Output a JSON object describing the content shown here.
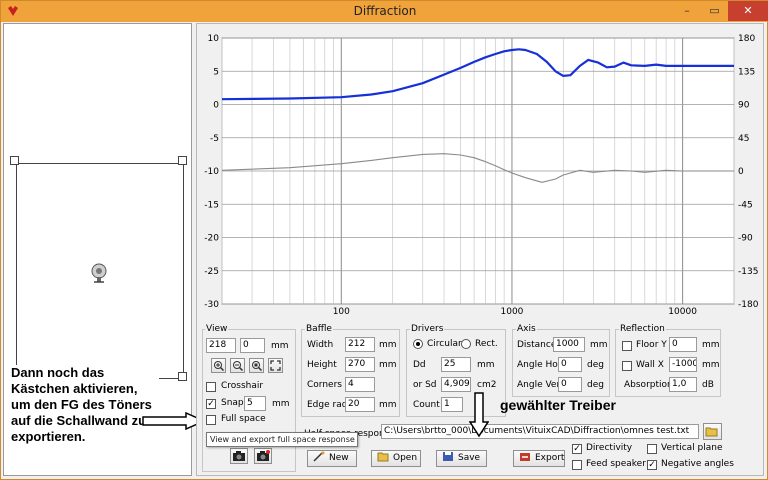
{
  "window": {
    "title": "Diffraction"
  },
  "titlebar": {
    "min_glyph": "–",
    "max_glyph": "▭",
    "close_glyph": "✕"
  },
  "annotations": {
    "left_note": "Dann noch das Kästchen aktivieren, um den FG des Töners auf die Schallwand zu exportieren.",
    "driver_note": "gewählter Treiber"
  },
  "view": {
    "group_label": "View",
    "coord_x": "218",
    "coord_y": "0",
    "coord_unit": "mm",
    "crosshair_label": "Crosshair",
    "crosshair_checked": false,
    "snap_label": "Snap",
    "snap_checked": true,
    "snap_value": "5",
    "snap_unit": "mm",
    "full_space_label": "Full space",
    "full_space_checked": false,
    "zoom_icons": [
      "zoom-in-icon",
      "zoom-out-icon",
      "zoom-window-icon",
      "zoom-extents-icon"
    ]
  },
  "tooltip": "View and export full space response",
  "baffle": {
    "group_label": "Baffle",
    "width_label": "Width",
    "width_value": "212",
    "width_unit": "mm",
    "height_label": "Height",
    "height_value": "270",
    "height_unit": "mm",
    "corners_label": "Corners",
    "corners_value": "4",
    "edge_label": "Edge rad.",
    "edge_value": "20",
    "edge_unit": "mm"
  },
  "drivers": {
    "group_label": "Drivers",
    "circular_label": "Circular",
    "circular_selected": true,
    "rect_label": "Rect.",
    "rect_selected": false,
    "dd_label": "Dd",
    "dd_value": "25",
    "dd_unit": "mm",
    "sd_label": "or Sd",
    "sd_value": "4,909",
    "sd_unit": "cm2",
    "count_label": "Count",
    "count_value": "1"
  },
  "axis": {
    "group_label": "Axis",
    "distance_label": "Distance",
    "distance_value": "1000",
    "distance_unit": "mm",
    "hor_label": "Angle Hor",
    "hor_value": "0",
    "hor_unit": "deg",
    "ver_label": "Angle Ver",
    "ver_value": "0",
    "ver_unit": "deg"
  },
  "reflection": {
    "group_label": "Reflection",
    "floor_label": "Floor Y",
    "floor_checked": false,
    "floor_value": "0",
    "floor_unit": "mm",
    "wall_label": "Wall  X",
    "wall_checked": false,
    "wall_value": "-1000",
    "wall_unit": "mm",
    "absorption_label": "Absorption",
    "absorption_value": "1,0",
    "absorption_unit": "dB"
  },
  "half_space": {
    "label": "Half space response",
    "path": "C:\\Users\\brtto_000\\Documents\\VituixCAD\\Diffraction\\omnes test.txt"
  },
  "buttons": {
    "new": "New",
    "open": "Open",
    "save": "Save",
    "export": "Export"
  },
  "options": {
    "directivity_label": "Directivity",
    "directivity_checked": true,
    "vertical_plane_label": "Vertical plane",
    "vertical_plane_checked": false,
    "feed_speaker_label": "Feed speaker",
    "feed_speaker_checked": false,
    "negative_angles_label": "Negative angles",
    "negative_angles_checked": true
  },
  "chart_data": {
    "type": "line",
    "x_scale": "log",
    "xlim": [
      20,
      20000
    ],
    "ylim": [
      -30,
      10
    ],
    "y2lim": [
      -180,
      180
    ],
    "grid": true,
    "x_tick_labels": [
      "100",
      "1000",
      "10000"
    ],
    "y_ticks": [
      10,
      5,
      0,
      -5,
      -10,
      -15,
      -20,
      -25,
      -30
    ],
    "y2_ticks": [
      180,
      135,
      90,
      45,
      0,
      -45,
      -90,
      -135,
      -180
    ],
    "series": [
      {
        "color": "#1530d8",
        "x": [
          20,
          50,
          100,
          150,
          200,
          300,
          400,
          500,
          600,
          700,
          800,
          900,
          1000,
          1100,
          1200,
          1400,
          1600,
          1800,
          2000,
          2200,
          2500,
          2800,
          3200,
          3600,
          4000,
          4500,
          5000,
          6000,
          7000,
          8000,
          10000,
          12000,
          15000,
          20000
        ],
        "y": [
          0.8,
          0.9,
          1.1,
          1.5,
          2.0,
          3.2,
          4.5,
          5.5,
          6.4,
          7.1,
          7.6,
          8.0,
          8.2,
          8.3,
          8.2,
          7.6,
          6.4,
          5.0,
          4.3,
          4.4,
          5.8,
          6.7,
          6.3,
          5.6,
          5.7,
          6.3,
          5.9,
          5.8,
          6.0,
          5.8,
          5.8,
          5.8,
          5.8,
          5.8
        ]
      },
      {
        "color": "#8a8a8a",
        "x": [
          20,
          50,
          100,
          150,
          200,
          300,
          400,
          500,
          600,
          700,
          800,
          900,
          1000,
          1200,
          1500,
          1800,
          2000,
          2500,
          3000,
          4000,
          5000,
          6000,
          8000,
          10000,
          12000,
          15000,
          20000
        ],
        "y": [
          -9.9,
          -9.5,
          -8.9,
          -8.4,
          -8.0,
          -7.5,
          -7.4,
          -7.6,
          -8.0,
          -8.6,
          -9.2,
          -9.8,
          -10.3,
          -11.0,
          -11.7,
          -11.2,
          -10.6,
          -9.9,
          -10.2,
          -9.9,
          -10.0,
          -10.2,
          -9.9,
          -10.0,
          -10.0,
          -10.0,
          -10.0
        ]
      }
    ]
  }
}
